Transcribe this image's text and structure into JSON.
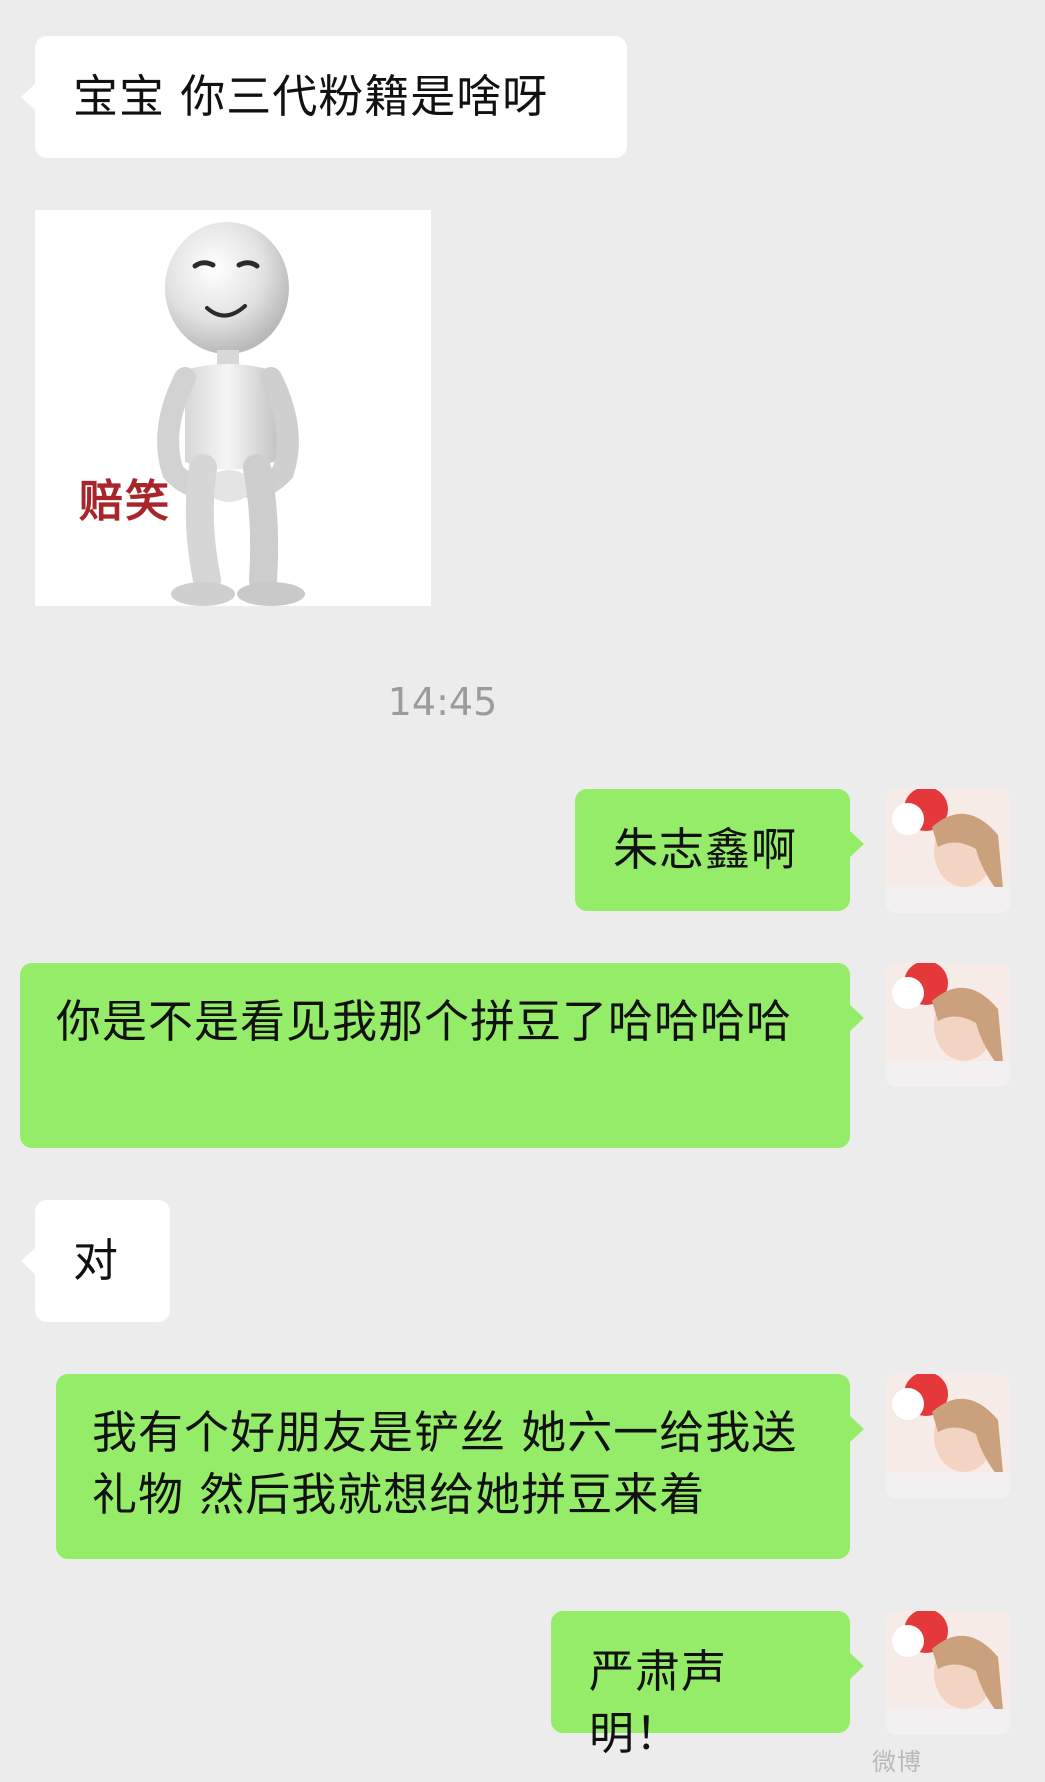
{
  "messages": [
    {
      "id": "m1",
      "side": "incoming",
      "text": "宝宝 你三代粉籍是啥呀"
    },
    {
      "id": "m2",
      "side": "incoming",
      "type": "sticker",
      "caption": "赔笑"
    },
    {
      "id": "m3",
      "side": "outgoing",
      "text": "朱志鑫啊"
    },
    {
      "id": "m4",
      "side": "outgoing",
      "text": "你是不是看见我那个拼豆了哈哈哈哈"
    },
    {
      "id": "m5",
      "side": "incoming",
      "text": "对"
    },
    {
      "id": "m6",
      "side": "outgoing",
      "text": "我有个好朋友是铲丝 她六一给我送礼物 然后我就想给她拼豆来着"
    },
    {
      "id": "m7",
      "side": "outgoing",
      "text": "严肃声明！"
    }
  ],
  "timestamp": "14:45",
  "colors": {
    "background": "#ececec",
    "incoming_bubble": "#ffffff",
    "outgoing_bubble": "#95ec69",
    "timestamp": "#9b9b9b",
    "sticker_caption": "#a8262b"
  },
  "icons": {
    "avatar": "user-avatar-photo",
    "sticker": "smiling-3d-figure-sticker"
  },
  "watermark": "微博"
}
